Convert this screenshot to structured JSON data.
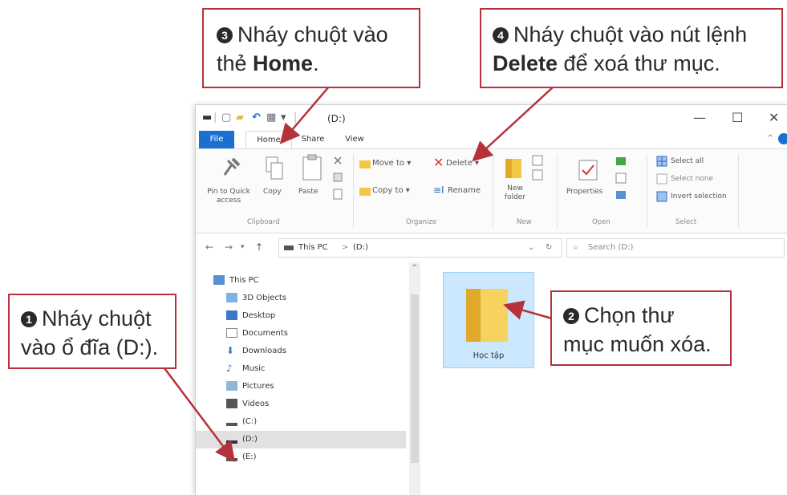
{
  "window": {
    "title": "(D:)",
    "tabs": [
      "File",
      "Home",
      "Share",
      "View"
    ],
    "controls": [
      "—",
      "☐",
      "✕"
    ],
    "quick_access": [
      "▬",
      "|",
      "▢",
      "▰",
      "↶",
      "▦",
      "▾",
      "|"
    ]
  },
  "ribbon": {
    "clipboard": {
      "pin_label": "Pin to Quick access",
      "copy_label": "Copy",
      "paste_label": "Paste",
      "group_label": "Clipboard"
    },
    "organize": {
      "move_to": "Move to ▾",
      "copy_to": "Copy to ▾",
      "delete": "Delete ▾",
      "rename": "Rename",
      "group_label": "Organize"
    },
    "new": {
      "new_folder": "New folder",
      "group_label": "New"
    },
    "open": {
      "properties": "Properties",
      "group_label": "Open"
    },
    "select": {
      "select_all": "Select all",
      "select_none": "Select none",
      "invert_selection": "Invert selection",
      "group_label": "Select"
    }
  },
  "address": {
    "path": [
      "This PC",
      ">",
      "(D:)"
    ],
    "search_placeholder": "Search (D:)"
  },
  "nav": {
    "items": [
      "This PC",
      "3D Objects",
      "Desktop",
      "Documents",
      "Downloads",
      "Music",
      "Pictures",
      "Videos",
      "(C:)",
      "(D:)",
      "(E:)"
    ]
  },
  "content": {
    "folder_name": "Học tập"
  },
  "callouts": {
    "c1": {
      "num": "1",
      "line1": "Nháy chuột",
      "line2": "vào ổ đĩa (D:)."
    },
    "c2": {
      "num": "2",
      "line1": "Chọn thư",
      "line2": "mục muốn xóa."
    },
    "c3": {
      "num": "3",
      "line1": "Nháy chuột vào",
      "line2_pre": "thẻ ",
      "line2_bold": "Home",
      "line2_post": "."
    },
    "c4": {
      "num": "4",
      "line1": "Nháy chuột vào nút lệnh",
      "line2_bold": "Delete",
      "line2_post": " để xoá thư mục."
    }
  },
  "colors": {
    "callout_border": "#b5323a",
    "file_tab": "#1a6fd1",
    "selection": "#cce8ff",
    "folder": "#f2c744",
    "delete_x": "#d23a2a"
  }
}
